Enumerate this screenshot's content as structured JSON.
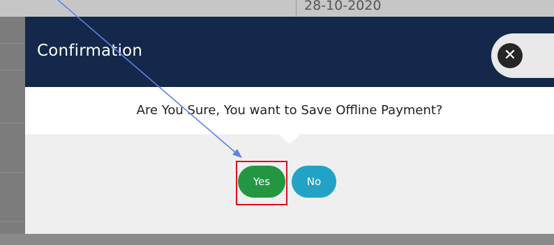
{
  "background": {
    "date_cell": "28-10-2020"
  },
  "dialog": {
    "title": "Confirmation",
    "message": "Are You Sure, You want to Save Offline Payment?",
    "close_icon": "times-circle-icon",
    "yes_label": "Yes",
    "no_label": "No"
  },
  "colors": {
    "header": "#13284a",
    "yes_button": "#249642",
    "no_button": "#22a3c6",
    "highlight": "#e00e1e",
    "arrow": "#5b82e8"
  }
}
